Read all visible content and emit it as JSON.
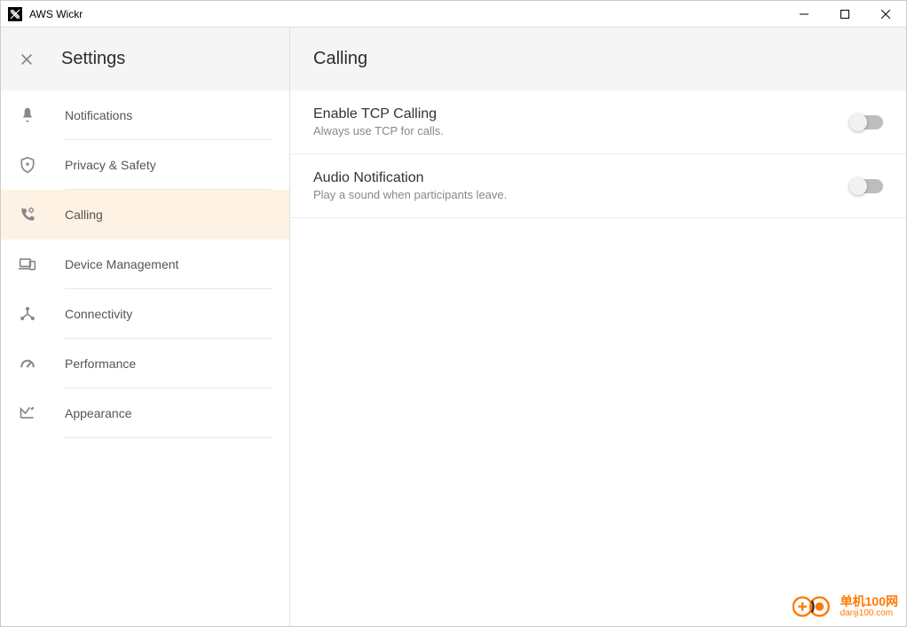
{
  "window": {
    "title": "AWS Wickr"
  },
  "sidebar": {
    "title": "Settings",
    "items": [
      {
        "label": "Notifications",
        "icon": "bell-icon",
        "active": false
      },
      {
        "label": "Privacy & Safety",
        "icon": "shield-icon",
        "active": false
      },
      {
        "label": "Calling",
        "icon": "phone-settings-icon",
        "active": true
      },
      {
        "label": "Device Management",
        "icon": "devices-icon",
        "active": false
      },
      {
        "label": "Connectivity",
        "icon": "hub-icon",
        "active": false
      },
      {
        "label": "Performance",
        "icon": "speedometer-icon",
        "active": false
      },
      {
        "label": "Appearance",
        "icon": "appearance-icon",
        "active": false
      }
    ]
  },
  "content": {
    "title": "Calling",
    "settings": [
      {
        "title": "Enable TCP Calling",
        "desc": "Always use TCP for calls.",
        "value": false
      },
      {
        "title": "Audio Notification",
        "desc": "Play a sound when participants leave.",
        "value": false
      }
    ]
  },
  "watermark": {
    "line1": "单机100网",
    "line2": "danji100.com"
  }
}
